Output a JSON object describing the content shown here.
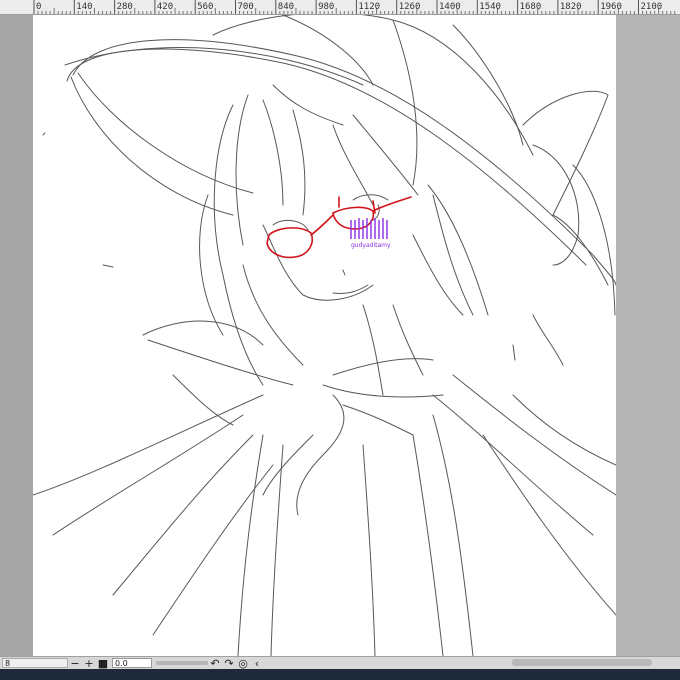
{
  "ruler": {
    "ticks": [
      "0",
      "140",
      "280",
      "420",
      "560",
      "700",
      "840",
      "980",
      "1120",
      "1260",
      "1400",
      "1540",
      "1680",
      "1820",
      "1960",
      "2100"
    ]
  },
  "canvas": {
    "signature_text": "gudyaditamy"
  },
  "bottom_bar": {
    "zoom_value": "8",
    "zoom_out_label": "−",
    "zoom_in_label": "+",
    "stop_label": "■",
    "angle_value": "0.0",
    "rotate_left_icon": "rotate-left-icon",
    "rotate_right_icon": "rotate-right-icon",
    "reset_rotation_icon": "reset-rotation-icon",
    "flip_icon": "flip-icon"
  },
  "colors": {
    "ruler_bg": "#ececec",
    "workspace_bg": "#a6a6a6",
    "canvas_bg": "#ffffff",
    "sketch_stroke": "#2a2a2a",
    "glasses_red": "#d0141c",
    "signature_purple": "#8a2be2",
    "taskbar": "#1e2a38"
  }
}
